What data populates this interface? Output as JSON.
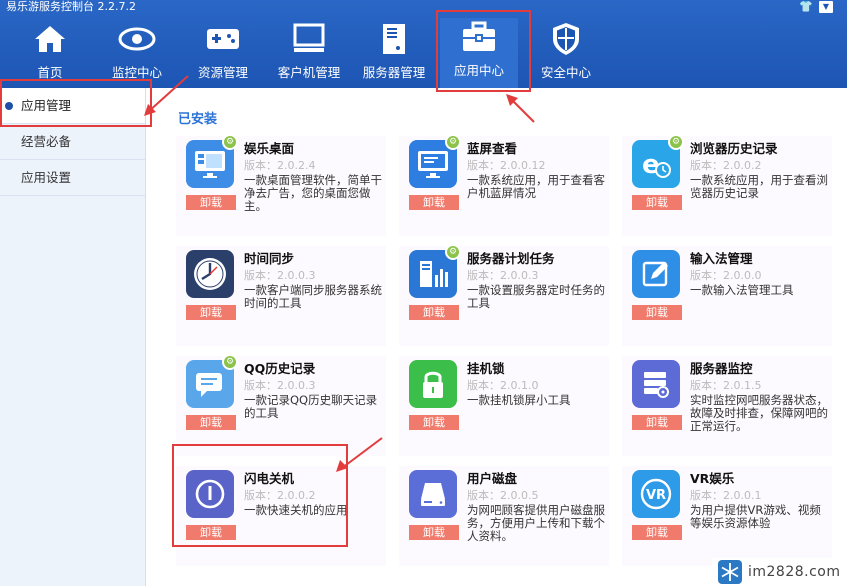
{
  "app": {
    "title": "易乐游服务控制台 2.2.7.2"
  },
  "nav": [
    {
      "label": "首页",
      "icon": "home-icon"
    },
    {
      "label": "监控中心",
      "icon": "eye-icon"
    },
    {
      "label": "资源管理",
      "icon": "gamepad-icon"
    },
    {
      "label": "客户机管理",
      "icon": "monitor-icon"
    },
    {
      "label": "服务器管理",
      "icon": "server-icon"
    },
    {
      "label": "应用中心",
      "icon": "toolbox-icon",
      "active": true
    },
    {
      "label": "安全中心",
      "icon": "shield-icon"
    }
  ],
  "sidebar": {
    "items": [
      {
        "label": "应用管理",
        "active": true
      },
      {
        "label": "经营必备"
      },
      {
        "label": "应用设置"
      }
    ]
  },
  "main": {
    "section_title": "已安装",
    "uninstall_label": "卸载",
    "apps": [
      {
        "name": "娱乐桌面",
        "version": "版本：2.0.2.4",
        "desc": "一款桌面管理软件，简单干净去广告，您的桌面您做主。",
        "icon": "desktop-app-icon",
        "color": "#3d8de6"
      },
      {
        "name": "蓝屏查看",
        "version": "版本：2.0.0.12",
        "desc": "一款系统应用，用于查看客户机蓝屏情况",
        "icon": "bluescreen-icon",
        "color": "#2e7de0"
      },
      {
        "name": "浏览器历史记录",
        "version": "版本：2.0.0.2",
        "desc": "一款系统应用，用于查看浏览器历史记录",
        "icon": "browser-history-icon",
        "color": "#2aa6e8"
      },
      {
        "name": "时间同步",
        "version": "版本：2.0.0.3",
        "desc": "一款客户端同步服务器系统时间的工具",
        "icon": "clock-icon",
        "color": "#2b3f6b"
      },
      {
        "name": "服务器计划任务",
        "version": "版本：2.0.0.3",
        "desc": "一款设置服务器定时任务的工具",
        "icon": "server-task-icon",
        "color": "#2a77d6"
      },
      {
        "name": "输入法管理",
        "version": "版本：2.0.0.0",
        "desc": "一款输入法管理工具",
        "icon": "pen-icon",
        "color": "#2f8fe6"
      },
      {
        "name": "QQ历史记录",
        "version": "版本：2.0.0.3",
        "desc": "一款记录QQ历史聊天记录的工具",
        "icon": "chat-icon",
        "color": "#5aa6ea"
      },
      {
        "name": "挂机锁",
        "version": "版本：2.0.1.0",
        "desc": "一款挂机锁屏小工具",
        "icon": "lock-icon",
        "color": "#3bbf4a"
      },
      {
        "name": "服务器监控",
        "version": "版本：2.0.1.5",
        "desc": "实时监控网吧服务器状态，故障及时排查，保障网吧的正常运行。",
        "icon": "server-monitor-icon",
        "color": "#5d6bd6"
      },
      {
        "name": "闪电关机",
        "version": "版本：2.0.0.2",
        "desc": "一款快速关机的应用",
        "icon": "power-icon",
        "color": "#5a63c8"
      },
      {
        "name": "用户磁盘",
        "version": "版本：2.0.0.5",
        "desc": "为网吧顾客提供用户磁盘服务，方便用户上传和下载个人资料。",
        "icon": "disk-icon",
        "color": "#5b6ed8"
      },
      {
        "name": "VR娱乐",
        "version": "版本：2.0.0.1",
        "desc": "为用户提供VR游戏、视频等娱乐资源体验",
        "icon": "vr-icon",
        "color": "#2e9be8"
      }
    ]
  },
  "watermark": {
    "text": "im2828.com"
  }
}
